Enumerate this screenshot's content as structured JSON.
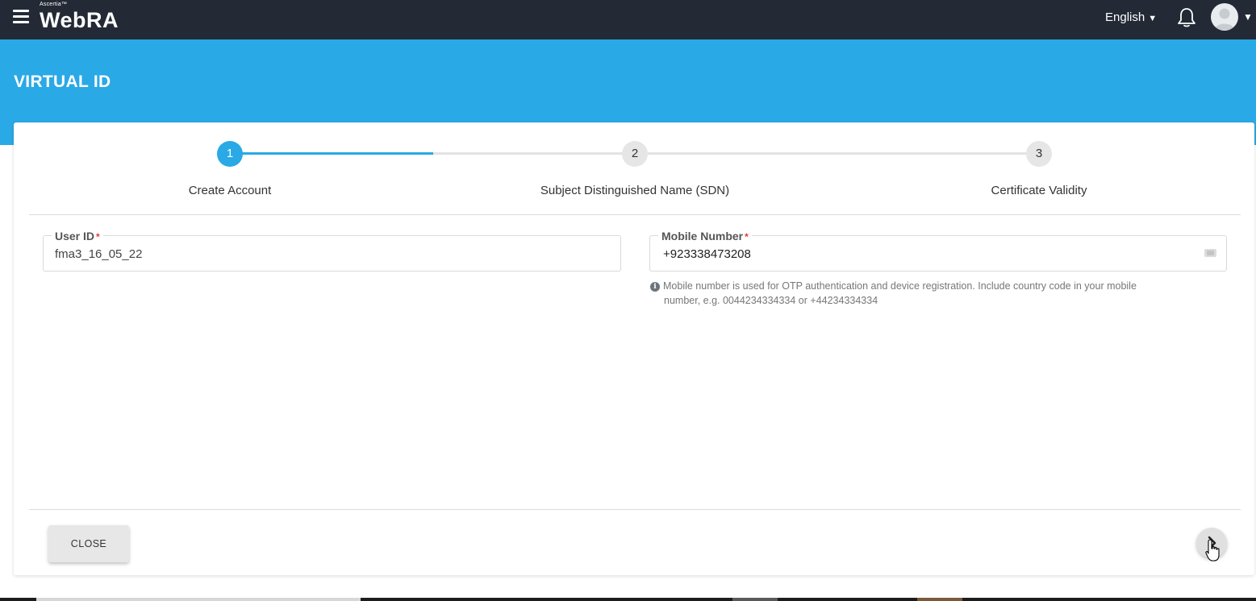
{
  "header": {
    "brand_small": "Ascertia™",
    "brand_main": "WebRA",
    "language": "English"
  },
  "page": {
    "title": "VIRTUAL ID"
  },
  "stepper": {
    "steps": [
      {
        "number": "1",
        "label": "Create Account",
        "active": true
      },
      {
        "number": "2",
        "label": "Subject Distinguished Name (SDN)",
        "active": false
      },
      {
        "number": "3",
        "label": "Certificate Validity",
        "active": false
      }
    ]
  },
  "form": {
    "user_id": {
      "label": "User ID",
      "required_mark": "*",
      "value": "fma3_16_05_22"
    },
    "mobile_number": {
      "label": "Mobile Number",
      "required_mark": "*",
      "value": "+923338473208",
      "hint_line1": "Mobile number is used for OTP authentication and device registration. Include country code in your mobile",
      "hint_line2": "number, e.g. 0044234334334 or +44234334334"
    }
  },
  "actions": {
    "close_label": "CLOSE"
  },
  "colors": {
    "topbar": "#232a36",
    "accent": "#29a9e6",
    "required": "#e53935"
  },
  "icons": {
    "menu": "hamburger-menu-icon",
    "notifications": "bell-icon",
    "user": "user-avatar-icon",
    "phone": "phone-icon",
    "info": "info-icon",
    "next": "chevron-right-icon"
  }
}
